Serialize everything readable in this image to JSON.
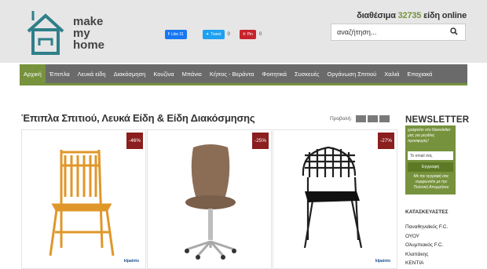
{
  "site": {
    "logo_line1": "make",
    "logo_line2": "my",
    "logo_line3": "home",
    "availability_prefix": "διαθέσιμα",
    "availability_count": "32735",
    "availability_suffix": "είδη online"
  },
  "search": {
    "placeholder": "αναζήτηση..."
  },
  "social": {
    "facebook_label": "Like 31",
    "twitter_label": "Tweet",
    "twitter_count": "0",
    "pinterest_label": "Pin",
    "pinterest_count": "0",
    "colors": {
      "facebook": "#1877f2",
      "twitter": "#1da1f2",
      "pinterest": "#c8232c"
    }
  },
  "nav": {
    "items": [
      "Αρχική",
      "Έπιπλα",
      "Λευκά είδη",
      "Διακόσμηση",
      "Κουζίνα",
      "Μπάνιο",
      "Κήπος - Βεράντα",
      "Φοιτητικά",
      "Συσκευές",
      "Οργάνωση Σπιτιού",
      "Χαλιά",
      "Εποχιακά"
    ],
    "active_index": 0,
    "colors": {
      "bar": "#6a6a6a",
      "accent": "#76923c"
    }
  },
  "main": {
    "title": "Έπιπλα Σπιτιού, Λευκά Είδη & Είδη Διακόσμησης",
    "view_label": "Προβολή:",
    "products": [
      {
        "discount": "-46%",
        "brand": "klpainto",
        "color": "#e0972a"
      },
      {
        "discount": "-25%",
        "brand": "",
        "color": "#8b6d56"
      },
      {
        "discount": "-27%",
        "brand": "klpainto",
        "color": "#1f1f1f"
      }
    ]
  },
  "newsletter": {
    "title": "NEWSLETTER",
    "description": "γραφτείτε στο Newsletter μας για μεγάλες προσφορές!",
    "email_placeholder": "Το email σας",
    "submit_label": "Εγγραφή",
    "terms": "Με την εγγραφή σας συμφωνείτε με την Πολιτική Απορρήτου"
  },
  "manufacturers": {
    "title": "ΚΑΤΑΣΚΕΥΑΣΤΕΣ",
    "items": [
      "Παναθηναϊκός F.C.",
      "ΟΥΟΥ",
      "Ολυμπιακός F.C.",
      "Κλαπάκης",
      "ΚΕΝΤΙΑ"
    ]
  }
}
